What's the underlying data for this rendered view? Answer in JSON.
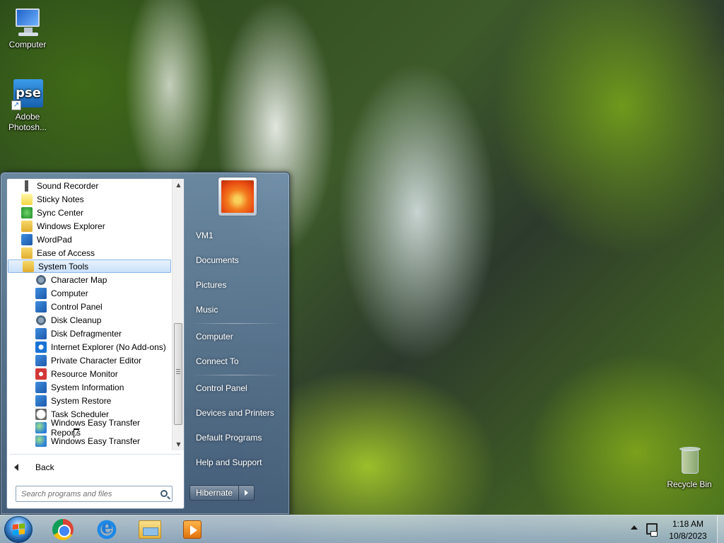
{
  "desktop": {
    "icons": [
      {
        "label": "Computer",
        "icon": "computer-icon"
      },
      {
        "label": "Adobe Photosh...",
        "icon": "photoshop-elements-icon",
        "badge": "pse"
      },
      {
        "label": "Recycle Bin",
        "icon": "recycle-bin-icon"
      }
    ]
  },
  "start_menu": {
    "programs": [
      {
        "label": "Sound Recorder",
        "icon": "microphone-icon",
        "indent": 0
      },
      {
        "label": "Sticky Notes",
        "icon": "sticky-notes-icon",
        "indent": 0
      },
      {
        "label": "Sync Center",
        "icon": "sync-center-icon",
        "indent": 0
      },
      {
        "label": "Windows Explorer",
        "icon": "windows-explorer-icon",
        "indent": 0
      },
      {
        "label": "WordPad",
        "icon": "wordpad-icon",
        "indent": 0
      },
      {
        "label": "Ease of Access",
        "icon": "folder-icon",
        "indent": 0
      },
      {
        "label": "System Tools",
        "icon": "folder-icon",
        "indent": 0,
        "selected": true
      },
      {
        "label": "Character Map",
        "icon": "character-map-icon",
        "indent": 1
      },
      {
        "label": "Computer",
        "icon": "computer-icon",
        "indent": 1
      },
      {
        "label": "Control Panel",
        "icon": "control-panel-icon",
        "indent": 1
      },
      {
        "label": "Disk Cleanup",
        "icon": "disk-cleanup-icon",
        "indent": 1
      },
      {
        "label": "Disk Defragmenter",
        "icon": "disk-defragmenter-icon",
        "indent": 1
      },
      {
        "label": "Internet Explorer (No Add-ons)",
        "icon": "internet-explorer-icon",
        "indent": 1
      },
      {
        "label": "Private Character Editor",
        "icon": "private-character-editor-icon",
        "indent": 1
      },
      {
        "label": "Resource Monitor",
        "icon": "resource-monitor-icon",
        "indent": 1
      },
      {
        "label": "System Information",
        "icon": "system-information-icon",
        "indent": 1
      },
      {
        "label": "System Restore",
        "icon": "system-restore-icon",
        "indent": 1
      },
      {
        "label": "Task Scheduler",
        "icon": "task-scheduler-icon",
        "indent": 1
      },
      {
        "label": "Windows Easy Transfer Reports",
        "icon": "easy-transfer-icon",
        "indent": 1
      },
      {
        "label": "Windows Easy Transfer",
        "icon": "easy-transfer-icon",
        "indent": 1
      }
    ],
    "back_label": "Back",
    "search_placeholder": "Search programs and files",
    "user_name": "VM1",
    "right_links": [
      {
        "label": "VM1",
        "group": 0
      },
      {
        "label": "Documents",
        "group": 0
      },
      {
        "label": "Pictures",
        "group": 0
      },
      {
        "label": "Music",
        "group": 0
      },
      {
        "label": "Computer",
        "group": 1
      },
      {
        "label": "Connect To",
        "group": 1
      },
      {
        "label": "Control Panel",
        "group": 2
      },
      {
        "label": "Devices and Printers",
        "group": 2
      },
      {
        "label": "Default Programs",
        "group": 2
      },
      {
        "label": "Help and Support",
        "group": 2
      }
    ],
    "shutdown_label": "Hibernate"
  },
  "taskbar": {
    "pinned": [
      {
        "icon": "chrome-icon"
      },
      {
        "icon": "internet-explorer-icon"
      },
      {
        "icon": "windows-explorer-icon"
      },
      {
        "icon": "media-player-icon"
      }
    ],
    "clock": {
      "time": "1:18 AM",
      "date": "10/8/2023"
    }
  },
  "colors": {
    "taskbar": "#b4c8dc",
    "start_menu": "#5d7b9a",
    "selected": "#c9e0f9"
  }
}
